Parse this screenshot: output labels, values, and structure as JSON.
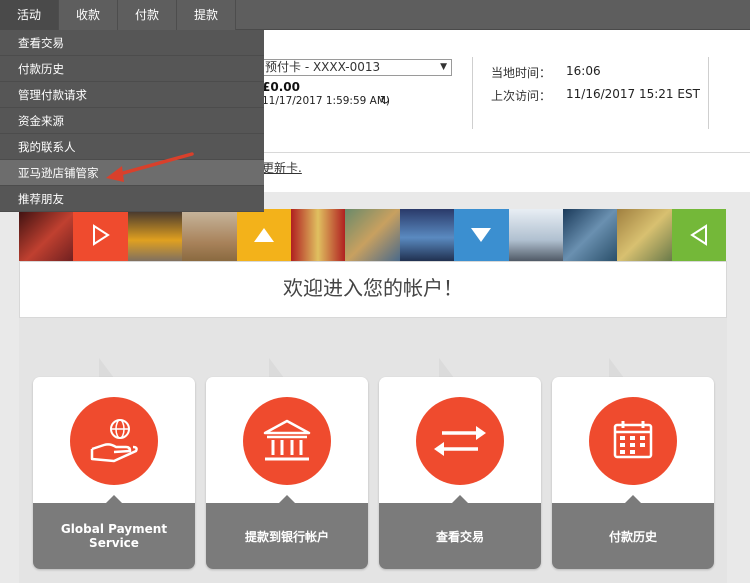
{
  "topnav": {
    "items": [
      {
        "label": "活动"
      },
      {
        "label": "收款"
      },
      {
        "label": "付款"
      },
      {
        "label": "提款"
      }
    ]
  },
  "dropdown": {
    "items": [
      {
        "label": "查看交易"
      },
      {
        "label": "付款历史"
      },
      {
        "label": "管理付款请求"
      },
      {
        "label": "资金来源"
      },
      {
        "label": "我的联系人"
      },
      {
        "label": "亚马逊店铺管家"
      },
      {
        "label": "推荐朋友"
      }
    ],
    "highlighted_item": "亚马逊店铺管家"
  },
  "account": {
    "card_select_value": "预付卡 - XXXX-0013",
    "balance": "£0.00",
    "balance_time": "11/17/2017 1:59:59 AM)",
    "local_time_label": "当地时间：",
    "local_time_value": "16:06",
    "last_visit_label": "上次访问：",
    "last_visit_value": "11/16/2017 15:21 EST",
    "update_card_link": "更新卡."
  },
  "banner": {
    "tiles": [
      {
        "kind": "photo",
        "color": "#7a2a2a"
      },
      {
        "kind": "icon",
        "color": "#ef4b2e",
        "icon": "play-outline-icon"
      },
      {
        "kind": "photo",
        "color": "#e0a020"
      },
      {
        "kind": "photo",
        "color": "#a8825a"
      },
      {
        "kind": "icon",
        "color": "#f3b21a",
        "icon": "triangle-up-icon"
      },
      {
        "kind": "photo",
        "color": "#c0392b"
      },
      {
        "kind": "photo",
        "color": "#4a7a5a"
      },
      {
        "kind": "photo",
        "color": "#3a6aa0"
      },
      {
        "kind": "icon",
        "color": "#3b8fd0",
        "icon": "triangle-down-icon"
      },
      {
        "kind": "photo",
        "color": "#d0d8e0"
      },
      {
        "kind": "photo",
        "color": "#2a4f6a"
      },
      {
        "kind": "photo",
        "color": "#c8a650"
      },
      {
        "kind": "icon",
        "color": "#74b839",
        "icon": "play-left-outline-icon"
      }
    ]
  },
  "welcome": {
    "title": "欢迎进入您的帐户！"
  },
  "cards": [
    {
      "label": "Global Payment Service",
      "icon": "globe-hand-icon"
    },
    {
      "label": "提款到银行帐户",
      "icon": "bank-icon"
    },
    {
      "label": "查看交易",
      "icon": "transfer-arrows-icon"
    },
    {
      "label": "付款历史",
      "icon": "calendar-icon"
    }
  ],
  "colors": {
    "accent_orange": "#ef4b2e",
    "nav_bg": "#5e5e5e",
    "menu_bg": "#565656",
    "card_footer": "#7b7b7b",
    "annotation_arrow": "#d9402b"
  }
}
